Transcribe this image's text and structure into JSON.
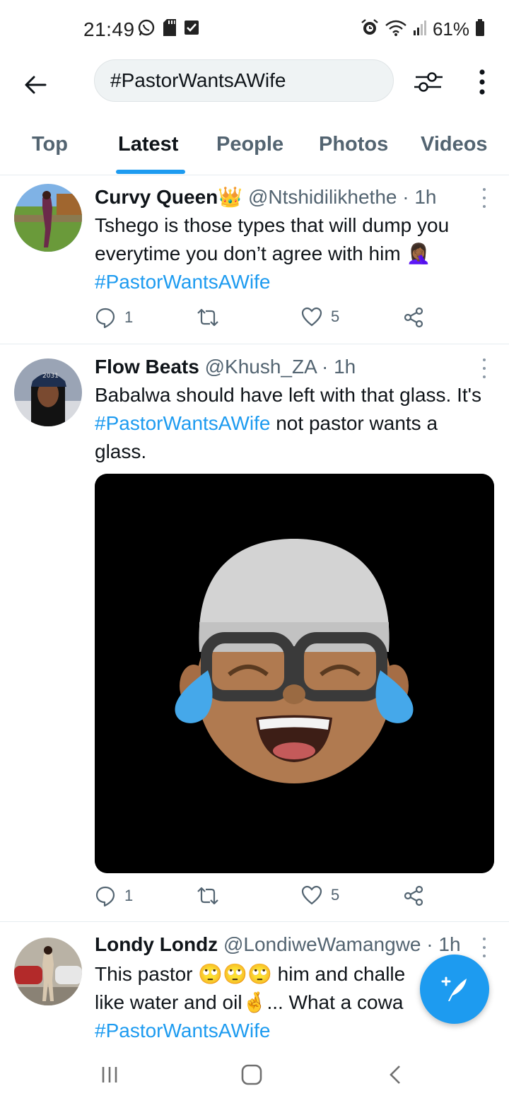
{
  "status_bar": {
    "time": "21:49",
    "battery": "61%"
  },
  "search": {
    "query": "#PastorWantsAWife"
  },
  "tabs": [
    {
      "label": "Top",
      "active": false
    },
    {
      "label": "Latest",
      "active": true
    },
    {
      "label": "People",
      "active": false
    },
    {
      "label": "Photos",
      "active": false
    },
    {
      "label": "Videos",
      "active": false
    }
  ],
  "tweets": [
    {
      "name": "Curvy Queen",
      "name_emoji": "👑",
      "handle": "@Ntshidilikhethe",
      "time": "· 1h",
      "text_1": "Tshego is those types that will dump you everytime you don’t agree with him",
      "text_emoji": "🤦🏾‍♀️",
      "hashtag": "#PastorWantsAWife",
      "replies": "1",
      "likes": "5"
    },
    {
      "name": "Flow Beats",
      "handle": "@Khush_ZA",
      "time": "· 1h",
      "text_1": "Babalwa should have left with that glass. It's",
      "hashtag": "#PastorWantsAWife",
      "text_2": "not pastor wants a glass.",
      "replies": "1",
      "likes": "5"
    },
    {
      "name": "Londy Londz",
      "handle": "@LondiweWamangwe",
      "time": "· 1h",
      "text_1": "This pastor",
      "text_emoji": "🙄🙄🙄",
      "text_2": "him and challe",
      "text_3": "like water and oil",
      "text_emoji_2": "🤞",
      "text_4": "... What a cowa",
      "hashtag": "#PastorWantsAWife"
    }
  ],
  "colors": {
    "accent": "#1d9bf0",
    "text": "#0f1419",
    "muted": "#536471"
  }
}
